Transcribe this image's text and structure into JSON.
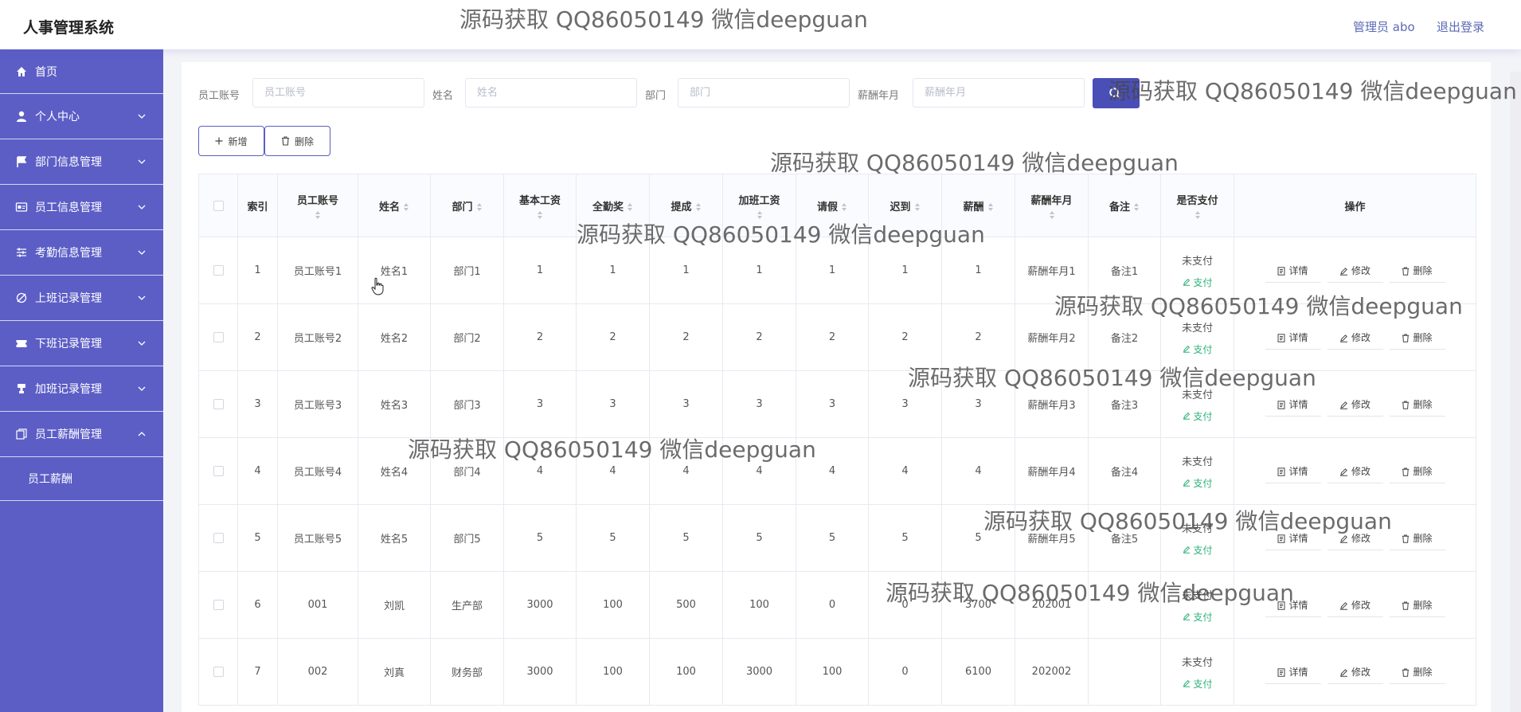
{
  "header": {
    "title": "人事管理系统",
    "user": "管理员 abo",
    "logout": "退出登录"
  },
  "sidebar": {
    "items": [
      {
        "label": "首页",
        "icon": "home-icon",
        "arrow": ""
      },
      {
        "label": "个人中心",
        "icon": "user-icon",
        "arrow": "down"
      },
      {
        "label": "部门信息管理",
        "icon": "flag-icon",
        "arrow": "down"
      },
      {
        "label": "员工信息管理",
        "icon": "id-card-icon",
        "arrow": "down"
      },
      {
        "label": "考勤信息管理",
        "icon": "sliders-icon",
        "arrow": "down"
      },
      {
        "label": "上班记录管理",
        "icon": "clock-in-icon",
        "arrow": "down"
      },
      {
        "label": "下班记录管理",
        "icon": "ticket-icon",
        "arrow": "down"
      },
      {
        "label": "加班记录管理",
        "icon": "stamp-icon",
        "arrow": "down"
      },
      {
        "label": "员工薪酬管理",
        "icon": "copy-icon",
        "arrow": "up"
      }
    ],
    "sub_item": "员工薪酬"
  },
  "search": {
    "fields": [
      {
        "label": "员工账号",
        "placeholder": "员工账号",
        "value": ""
      },
      {
        "label": "姓名",
        "placeholder": "姓名",
        "value": ""
      },
      {
        "label": "部门",
        "placeholder": "部门",
        "value": ""
      },
      {
        "label": "薪酬年月",
        "placeholder": "薪酬年月",
        "value": ""
      }
    ]
  },
  "toolbar": {
    "add": "新增",
    "delete": "删除"
  },
  "table": {
    "headers": [
      "索引",
      "员工账号",
      "姓名",
      "部门",
      "基本工资",
      "全勤奖",
      "提成",
      "加班工资",
      "请假",
      "迟到",
      "薪酬",
      "薪酬年月",
      "备注",
      "是否支付",
      "操作"
    ],
    "rows": [
      [
        "1",
        "员工账号1",
        "姓名1",
        "部门1",
        "1",
        "1",
        "1",
        "1",
        "1",
        "1",
        "1",
        "薪酬年月1",
        "备注1",
        "未支付"
      ],
      [
        "2",
        "员工账号2",
        "姓名2",
        "部门2",
        "2",
        "2",
        "2",
        "2",
        "2",
        "2",
        "2",
        "薪酬年月2",
        "备注2",
        "未支付"
      ],
      [
        "3",
        "员工账号3",
        "姓名3",
        "部门3",
        "3",
        "3",
        "3",
        "3",
        "3",
        "3",
        "3",
        "薪酬年月3",
        "备注3",
        "未支付"
      ],
      [
        "4",
        "员工账号4",
        "姓名4",
        "部门4",
        "4",
        "4",
        "4",
        "4",
        "4",
        "4",
        "4",
        "薪酬年月4",
        "备注4",
        "未支付"
      ],
      [
        "5",
        "员工账号5",
        "姓名5",
        "部门5",
        "5",
        "5",
        "5",
        "5",
        "5",
        "5",
        "5",
        "薪酬年月5",
        "备注5",
        "未支付"
      ],
      [
        "6",
        "001",
        "刘凯",
        "生产部",
        "3000",
        "100",
        "500",
        "100",
        "0",
        "0",
        "3700",
        "202001",
        "",
        "未支付"
      ],
      [
        "7",
        "002",
        "刘真",
        "财务部",
        "3000",
        "100",
        "100",
        "3000",
        "100",
        "0",
        "6100",
        "202002",
        "",
        "未支付"
      ]
    ],
    "pay_label": "支付",
    "actions": {
      "detail": "详情",
      "edit": "修改",
      "delete": "删除"
    }
  },
  "watermark": "源码获取 QQ86050149 微信deepguan",
  "colors": {
    "sidebar": "#5c5ec6",
    "primary": "#4a4fb7",
    "pay": "#2cb27a"
  }
}
